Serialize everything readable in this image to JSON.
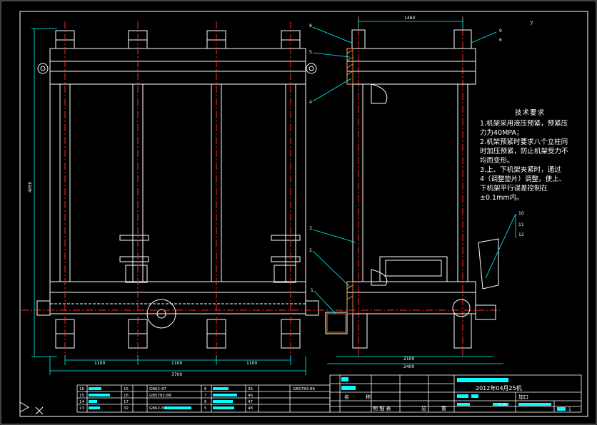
{
  "page_number": "7",
  "dims": {
    "top_width": "1460",
    "height": "4850",
    "span_1": "1100",
    "span_2": "1100",
    "span_3": "1100",
    "total_width": "3700",
    "bottom_width_1": "2100",
    "bottom_width_2": "2400"
  },
  "callouts": [
    "8",
    "9",
    "5",
    "6",
    "4",
    "3",
    "2",
    "1",
    "10",
    "11",
    "12"
  ],
  "notes": {
    "title": "技术要求",
    "lines": [
      "1.机架采用液压预紧，预紧压",
      "力为40MPA；",
      "2.机架预紧时要求八个立柱同",
      "时加压预紧，防止机架受力不",
      "均而变形。",
      "3.上、下机架夹紧时，通过",
      "4（调整垫片）调整，使上、",
      "下机架平行误差控制在",
      "±0.1mm内。"
    ]
  },
  "bom": {
    "rows_left": [
      {
        "no": "16",
        "qty": "15"
      },
      {
        "no": "15",
        "qty": "16"
      },
      {
        "no": "14",
        "qty": "17"
      },
      {
        "no": "13",
        "qty": "32"
      }
    ],
    "std_left": [
      "GB62-87",
      "GB5782-86",
      "",
      "GB62-87"
    ],
    "rows_mid": [
      {
        "no": "8",
        "qty": "36"
      },
      {
        "no": "7",
        "qty": "46"
      },
      {
        "no": "6",
        "qty": "47"
      },
      {
        "no": "5",
        "qty": "48"
      }
    ],
    "std_mid": [
      "GB5783-86",
      "",
      "",
      ""
    ],
    "header_name": "名",
    "header_code": "称",
    "footer_list": "明 细 表",
    "footer_total": "总",
    "footer_weight": "重"
  },
  "title_block": {
    "title": "2012年04月25机",
    "label": "加口",
    "scale": "1:10",
    "sheet": "1"
  },
  "colors": {
    "background": "#000000",
    "outline": "#ffffff",
    "centerline": "#ff2a2a",
    "dimension": "#00ffff",
    "highlight": "#00ffff"
  }
}
